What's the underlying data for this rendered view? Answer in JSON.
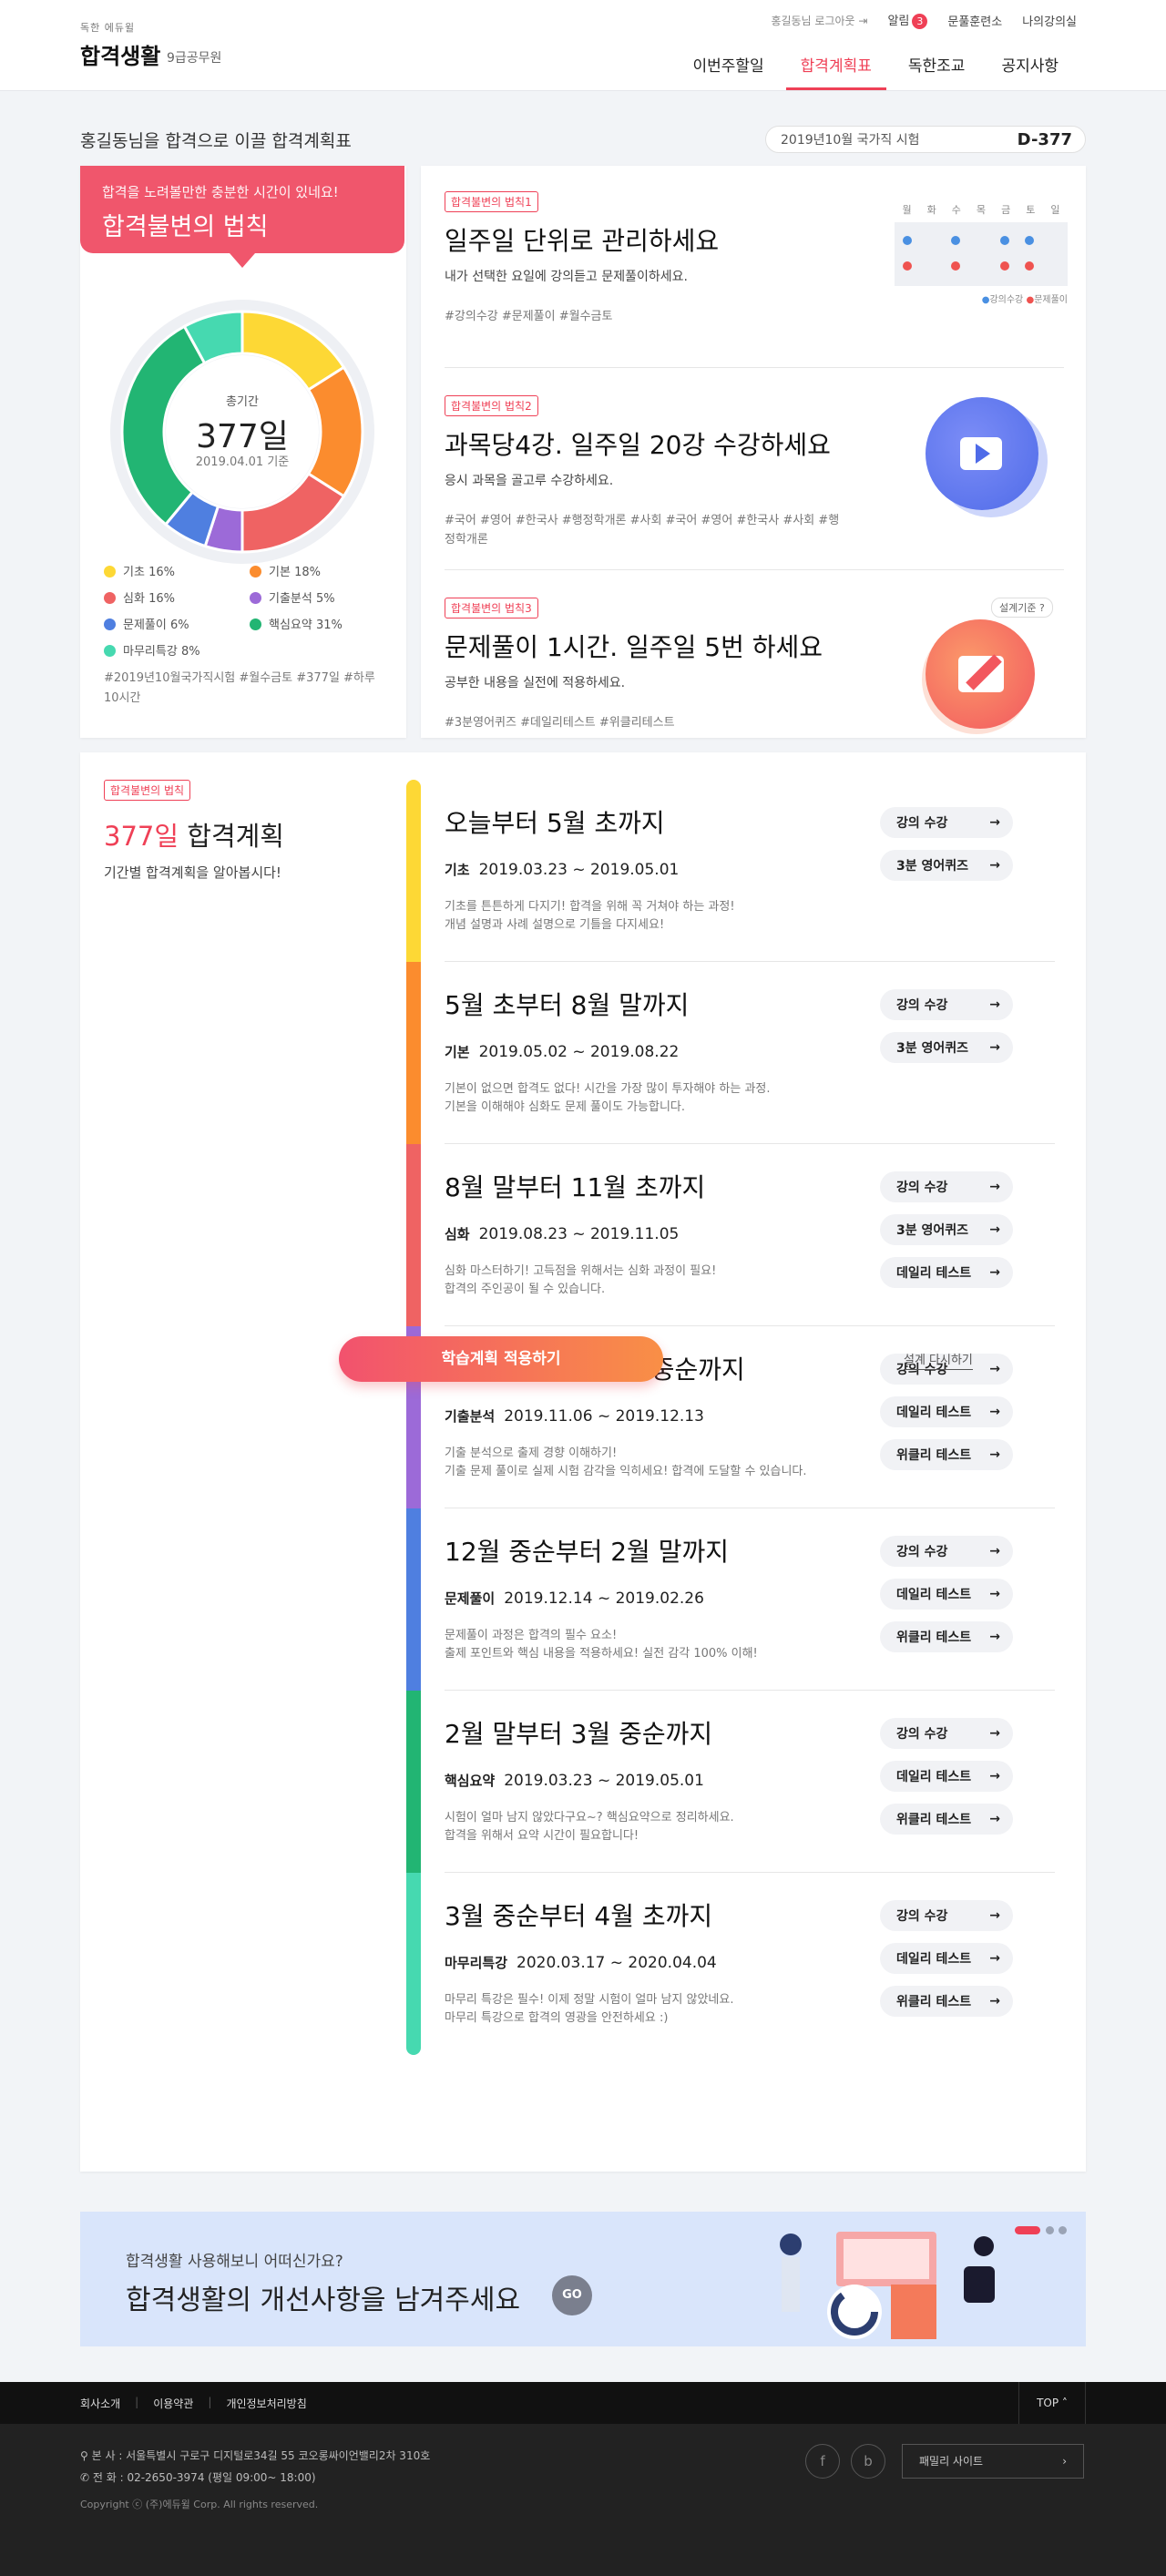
{
  "header": {
    "logo_small": "독한 에듀윌",
    "logo": "합격생활",
    "logo_sub": "9급공무원",
    "login_text": "홍길동님 로그아웃",
    "alarm": "알림",
    "alarm_count": "3",
    "qna": "문풀훈련소",
    "myroom": "나의강의실",
    "nav": [
      "이번주할일",
      "합격계획표",
      "독한조교",
      "공지사항"
    ]
  },
  "top": {
    "greeting": "홍길동님을 합격으로 이끌 합격계획표",
    "exam": "2019년10월 국가직 시험",
    "dday": "D-377"
  },
  "law": {
    "sub": "합격을 노려볼만한 충분한 시간이 있네요!",
    "title": "합격불변의 법칙",
    "total_label": "총기간",
    "days": "377일",
    "base": "2019.04.01 기준",
    "legend": [
      {
        "name": "기초",
        "pct": "16%",
        "color": "#fdd835",
        "value": 16
      },
      {
        "name": "기본",
        "pct": "18%",
        "color": "#fb8c2e",
        "value": 18
      },
      {
        "name": "심화",
        "pct": "16%",
        "color": "#ef6363",
        "value": 16
      },
      {
        "name": "기출분석",
        "pct": "5%",
        "color": "#9c6ad8",
        "value": 5
      },
      {
        "name": "문제풀이",
        "pct": "6%",
        "color": "#4f7fe0",
        "value": 6
      },
      {
        "name": "핵심요약",
        "pct": "31%",
        "color": "#22b573",
        "value": 31
      },
      {
        "name": "마무리특강",
        "pct": "8%",
        "color": "#46d9b0",
        "value": 8
      }
    ],
    "tags": "#2019년10월국가직시험 #월수금토 #377일 #하루10시간"
  },
  "rules": [
    {
      "tag": "합격불변의 법칙1",
      "title": "일주일 단위로 관리하세요",
      "sub": "내가 선택한 요일에 강의듣고 문제풀이하세요.",
      "hash": "#강의수강 #문제풀이 #월수금토",
      "days": [
        "월",
        "화",
        "수",
        "목",
        "금",
        "토",
        "일"
      ],
      "leg1": "강의수강",
      "leg2": "문제풀이"
    },
    {
      "tag": "합격불변의 법칙2",
      "title": "과목당4강. 일주일 20강 수강하세요",
      "sub": "응시 과목을 골고루 수강하세요.",
      "hash": "#국어 #영어 #한국사 #행정학개론 #사회 #국어 #영어 #한국사 #사회 #행정학개론"
    },
    {
      "tag": "합격불변의 법칙3",
      "title": "문제풀이 1시간. 일주일 5번 하세요",
      "sub": "공부한 내용을 실전에 적용하세요.",
      "hash": "#3분영어퀴즈 #데일리테스트 #위클리테스트",
      "setting": "설계기준"
    }
  ],
  "plan": {
    "tag": "합격불변의 법칙",
    "days": "377일",
    "title": "합격계획",
    "sub": "기간별 합격계획을 알아봅시다!",
    "apply": "학습계획 적용하기",
    "reset": "설계 다시하기"
  },
  "stages": [
    {
      "head": "오늘부터 5월 초까지",
      "name": "기초",
      "date": "2019.03.23 ~ 2019.05.01",
      "d1": "기초를 튼튼하게 다지기! 합격을 위해 꼭 거쳐야 하는 과정!",
      "d2": "개념 설명과 사례 설명으로 기틀을 다지세요!",
      "btns": [
        "강의 수강",
        "3분 영어퀴즈"
      ]
    },
    {
      "head": "5월 초부터 8월 말까지",
      "name": "기본",
      "date": "2019.05.02 ~ 2019.08.22",
      "d1": "기본이 없으면 합격도 없다! 시간을 가장 많이 투자해야 하는 과정.",
      "d2": "기본을 이해해야 심화도 문제 풀이도 가능합니다.",
      "btns": [
        "강의 수강",
        "3분 영어퀴즈"
      ]
    },
    {
      "head": "8월 말부터 11월 초까지",
      "name": "심화",
      "date": "2019.08.23 ~ 2019.11.05",
      "d1": "심화 마스터하기! 고득점을 위해서는 심화 과정이 필요!",
      "d2": "합격의 주인공이 될 수 있습니다.",
      "btns": [
        "강의 수강",
        "3분 영어퀴즈",
        "데일리 테스트"
      ]
    },
    {
      "head": "11월 초부터 12월 중순까지",
      "name": "기출분석",
      "date": "2019.11.06 ~ 2019.12.13",
      "d1": "기출 분석으로 출제 경향 이해하기!",
      "d2": "기출 문제 풀이로 실제 시험 감각을 익히세요! 합격에 도달할 수 있습니다.",
      "btns": [
        "강의 수강",
        "데일리 테스트",
        "위클리 테스트"
      ]
    },
    {
      "head": "12월 중순부터 2월 말까지",
      "name": "문제풀이",
      "date": "2019.12.14 ~ 2019.02.26",
      "d1": "문제풀이 과정은 합격의 필수 요소!",
      "d2": "출제 포인트와 핵심 내용을 적용하세요! 실전 감각 100% 이해!",
      "btns": [
        "강의 수강",
        "데일리 테스트",
        "위클리 테스트"
      ]
    },
    {
      "head": "2월 말부터 3월 중순까지",
      "name": "핵심요약",
      "date": "2019.03.23 ~ 2019.05.01",
      "d1": "시험이 얼마 남지 않았다구요~? 핵심요약으로 정리하세요.",
      "d2": "합격을 위해서 요약 시간이 필요합니다!",
      "btns": [
        "강의 수강",
        "데일리 테스트",
        "위클리 테스트"
      ]
    },
    {
      "head": "3월 중순부터 4월 초까지",
      "name": "마무리특강",
      "date": "2020.03.17 ~ 2020.04.04",
      "d1": "마무리 특강은 필수! 이제 정말 시험이 얼마 남지 않았네요.",
      "d2": "마무리 특강으로 합격의 영광을 안전하세요 :)",
      "btns": [
        "강의 수강",
        "데일리 테스트",
        "위클리 테스트"
      ]
    }
  ],
  "banner": {
    "sub": "합격생활 사용해보니 어떠신가요?",
    "title": "합격생활의 개선사항을 남겨주세요",
    "go": "GO"
  },
  "footer": {
    "links": [
      "회사소개",
      "이용약관",
      "개인정보처리방침"
    ],
    "top": "TOP",
    "addr": "본 사 : 서울특별시 구로구 디지털로34길 55 코오롱싸이언밸리2차 310호",
    "tel": "전 화 : 02-2650-3974 (평일 09:00~ 18:00)",
    "copy": "Copyright ⓒ (주)에듀윌 Corp. All rights reserved.",
    "family": "패밀리 사이트"
  }
}
